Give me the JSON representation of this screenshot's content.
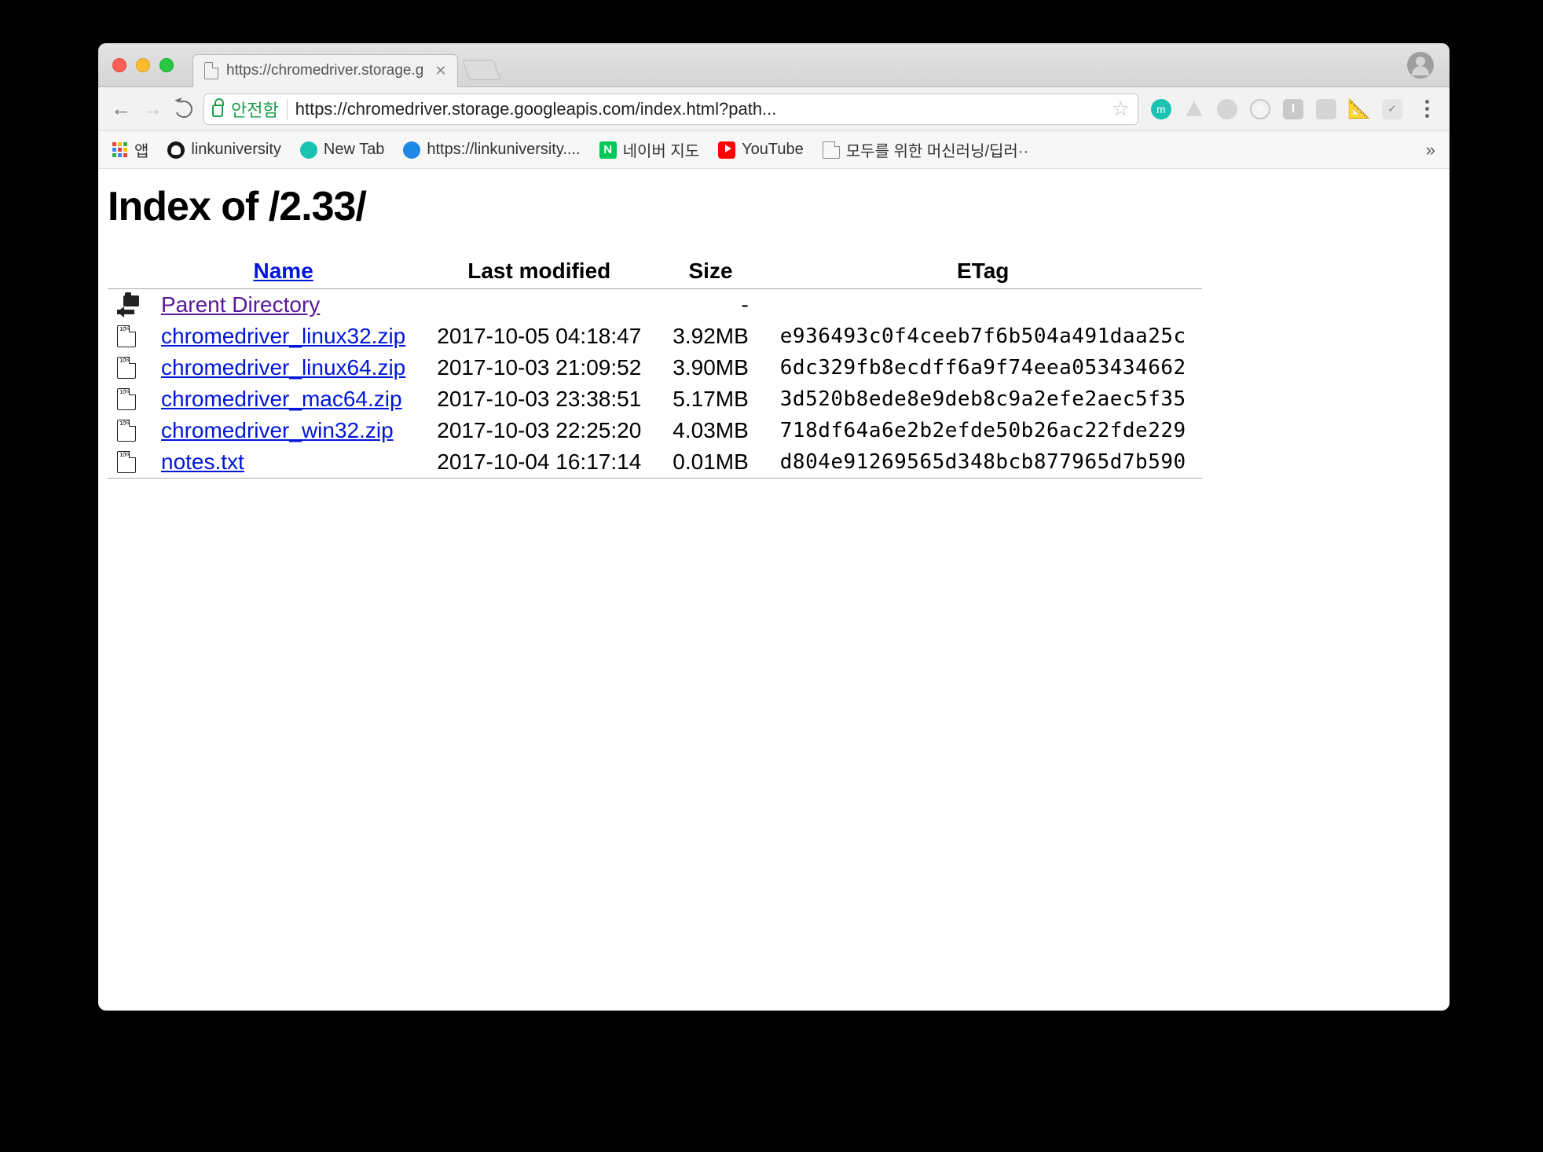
{
  "browser": {
    "tab_title": "https://chromedriver.storage.g",
    "secure_label": "안전함",
    "url": "https://chromedriver.storage.googleapis.com/index.html?path...",
    "bookmarks": {
      "apps": "앱",
      "items": [
        {
          "label": "linkuniversity",
          "icon": "github"
        },
        {
          "label": "New Tab",
          "icon": "teal"
        },
        {
          "label": "https://linkuniversity....",
          "icon": "blue"
        },
        {
          "label": "네이버 지도",
          "icon": "naver"
        },
        {
          "label": "YouTube",
          "icon": "youtube"
        },
        {
          "label": "모두를 위한 머신러닝/딥러··",
          "icon": "doc"
        }
      ]
    }
  },
  "page": {
    "heading": "Index of /2.33/",
    "columns": {
      "name": "Name",
      "modified": "Last modified",
      "size": "Size",
      "etag": "ETag"
    },
    "parent": {
      "label": "Parent Directory",
      "size": "-"
    },
    "files": [
      {
        "name": "chromedriver_linux32.zip",
        "modified": "2017-10-05 04:18:47",
        "size": "3.92MB",
        "etag": "e936493c0f4ceeb7f6b504a491daa25c"
      },
      {
        "name": "chromedriver_linux64.zip",
        "modified": "2017-10-03 21:09:52",
        "size": "3.90MB",
        "etag": "6dc329fb8ecdff6a9f74eea053434662"
      },
      {
        "name": "chromedriver_mac64.zip",
        "modified": "2017-10-03 23:38:51",
        "size": "5.17MB",
        "etag": "3d520b8ede8e9deb8c9a2efe2aec5f35"
      },
      {
        "name": "chromedriver_win32.zip",
        "modified": "2017-10-03 22:25:20",
        "size": "4.03MB",
        "etag": "718df64a6e2b2efde50b26ac22fde229"
      },
      {
        "name": "notes.txt",
        "modified": "2017-10-04 16:17:14",
        "size": "0.01MB",
        "etag": "d804e91269565d348bcb877965d7b590"
      }
    ]
  }
}
